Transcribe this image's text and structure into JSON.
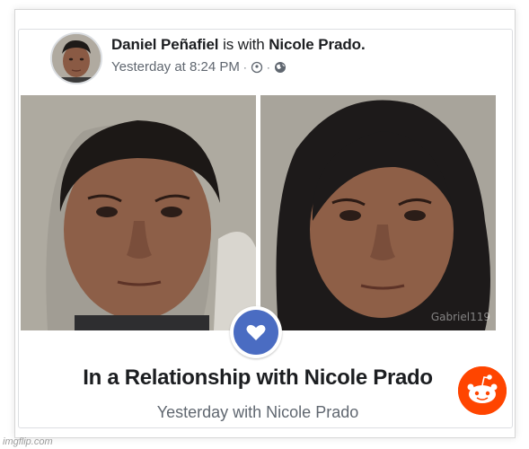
{
  "post": {
    "author": "Daniel Peñafiel",
    "with_text": "is with",
    "tagged": "Nicole Prado.",
    "timestamp": "Yesterday at 8:24 PM",
    "separator": "·"
  },
  "photos": {
    "watermark": "Gabriel119"
  },
  "life_event": {
    "headline": "In a Relationship with Nicole Prado",
    "subline": "Yesterday with Nicole Prado"
  },
  "footer": {
    "imgflip": "imgflip.com"
  },
  "icons": {
    "privacy": "friends-icon",
    "audience": "globe-icon",
    "badge": "heart-icon",
    "overlay": "reddit-icon"
  },
  "colors": {
    "badge_blue": "#4a6cc2",
    "reddit_orange": "#ff4500",
    "text_primary": "#1c1e21",
    "text_secondary": "#606770"
  }
}
